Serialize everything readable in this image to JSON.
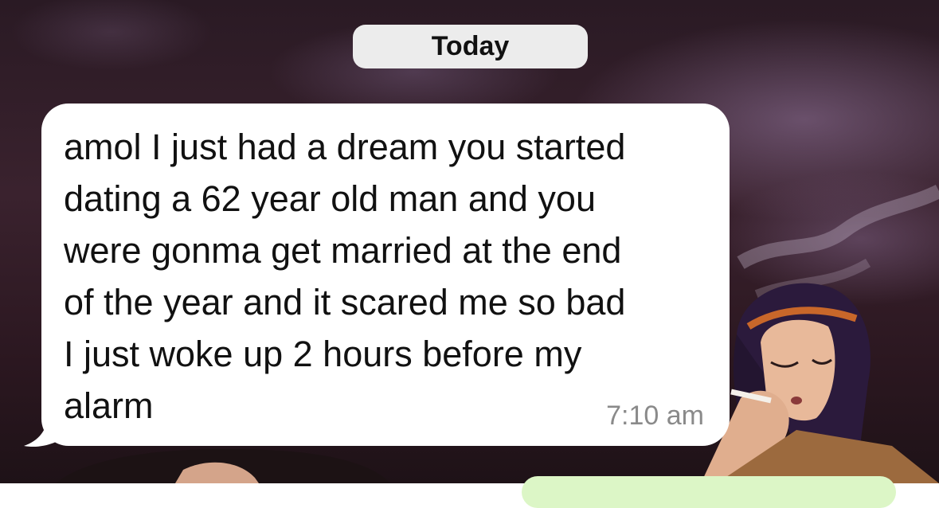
{
  "chat": {
    "date_divider": "Today",
    "message": {
      "text": "amol I just had a dream you started\ndating a 62 year old man and you\nwere gonma get married at the end\nof the year and it scared me so bad\nI just woke up 2 hours before my\nalarm",
      "time": "7:10 am",
      "direction": "incoming"
    }
  },
  "colors": {
    "incoming_bubble": "#ffffff",
    "outgoing_bubble": "#dcf6c6",
    "date_pill": "#ececec",
    "timestamp": "#8a8a8a",
    "wallpaper_base": "#2a1a24"
  }
}
